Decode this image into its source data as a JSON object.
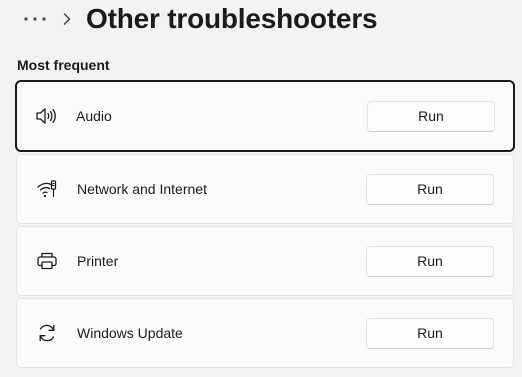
{
  "header": {
    "more_icon": "more-horizontal-icon",
    "chevron_icon": "chevron-right-icon",
    "title": "Other troubleshooters"
  },
  "sections": {
    "most_frequent": {
      "title": "Most frequent",
      "items": [
        {
          "label": "Audio",
          "icon": "speaker-icon",
          "button": "Run",
          "focused": true
        },
        {
          "label": "Network and Internet",
          "icon": "network-wifi-icon",
          "button": "Run",
          "focused": false
        },
        {
          "label": "Printer",
          "icon": "printer-icon",
          "button": "Run",
          "focused": false
        },
        {
          "label": "Windows Update",
          "icon": "sync-update-icon",
          "button": "Run",
          "focused": false
        }
      ]
    }
  }
}
